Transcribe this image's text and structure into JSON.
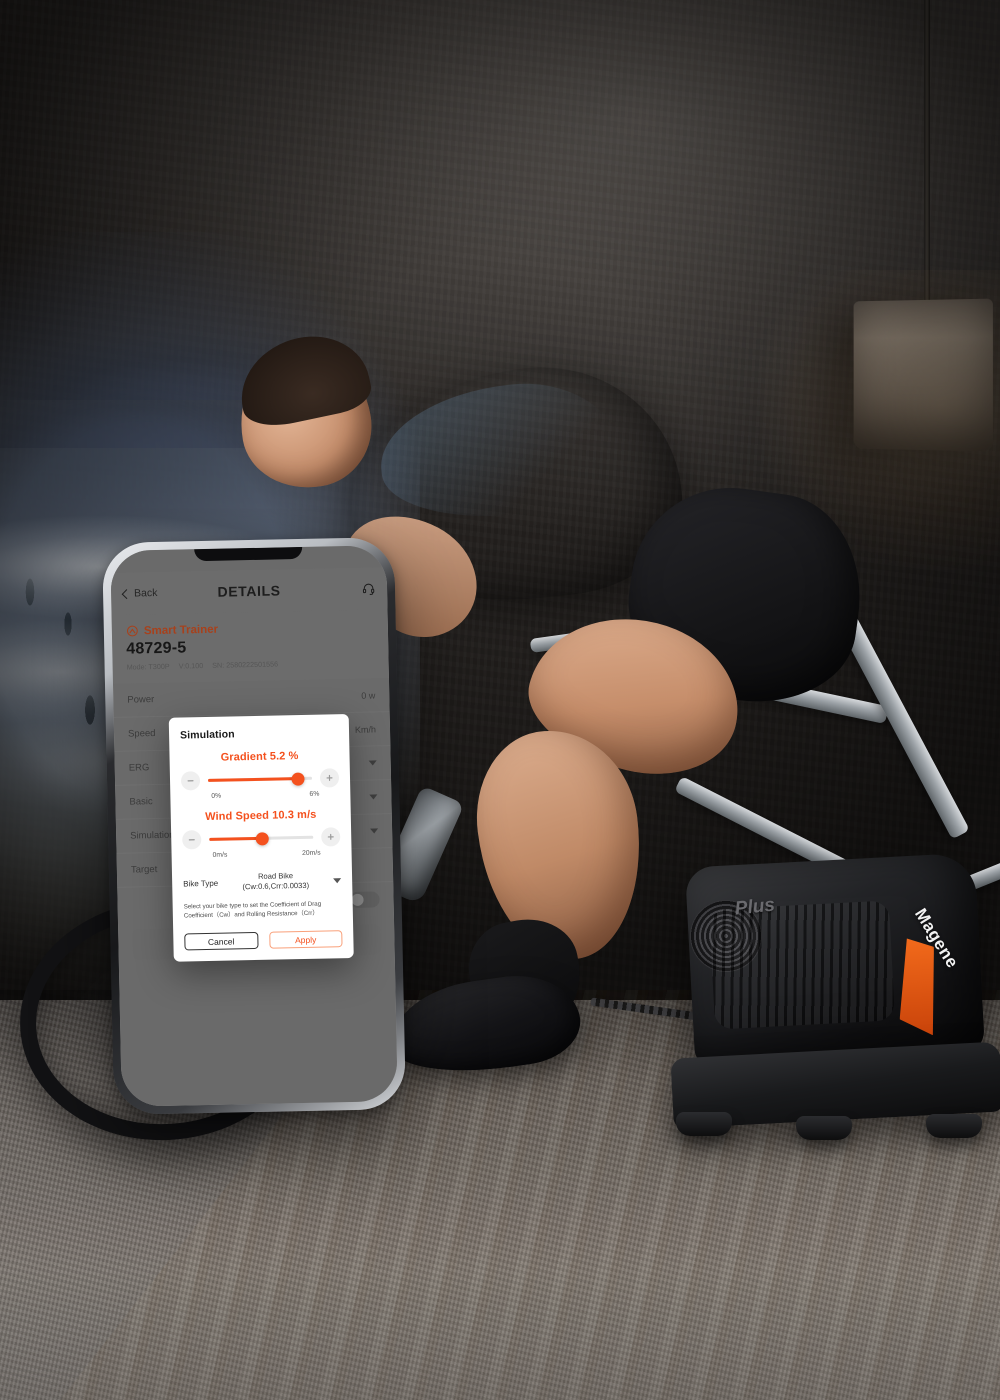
{
  "scene": {
    "description": "Cyclist riding road bike on Magene smart trainer indoors",
    "trainer_brand": "Magene",
    "trainer_model_badge": "Plus",
    "accent_color": "#f4511e",
    "orange_accent": "#f26a1b"
  },
  "phone": {
    "navbar": {
      "back_label": "Back",
      "title": "DETAILS",
      "help_icon": "headset-icon"
    },
    "device": {
      "type_icon": "smart-trainer-icon",
      "type_label": "Smart Trainer",
      "name": "48729-5",
      "mode_label": "Mode: T300P",
      "version_label": "V:0.100",
      "serial_label": "SN: 2580222501556"
    },
    "rows": [
      {
        "label": "Power",
        "value": "0 w",
        "control": "none"
      },
      {
        "label": "Speed",
        "value": "Km/h",
        "control": "none"
      },
      {
        "label": "ERG",
        "value": "",
        "control": "caret"
      },
      {
        "label": "Basic",
        "value": "",
        "control": "caret"
      },
      {
        "label": "Simulation",
        "value": "",
        "control": "caret"
      },
      {
        "label": "Target",
        "value": "",
        "control": "none"
      }
    ]
  },
  "dialog": {
    "title": "Simulation",
    "gradient": {
      "label": "Gradient 5.2 %",
      "min_label": "0%",
      "max_label": "6%",
      "value": 5.2,
      "min": 0,
      "max": 6,
      "percent": 87,
      "minus_icon": "minus-icon",
      "plus_icon": "plus-icon"
    },
    "wind": {
      "label": "Wind Speed 10.3 m/s",
      "min_label": "0m/s",
      "max_label": "20m/s",
      "value": 10.3,
      "min": 0,
      "max": 20,
      "percent": 51,
      "minus_icon": "minus-icon",
      "plus_icon": "plus-icon"
    },
    "bike_type": {
      "label": "Bike Type",
      "value_line1": "Road Bike",
      "value_line2": "(Cw:0.6,Crr:0.0033)",
      "caret_icon": "chevron-down-icon"
    },
    "hint": "Select your bike type to set the Coefficient of Drag Coefficient（Cw）and Rolling Resistance（Crr）",
    "cancel_label": "Cancel",
    "apply_label": "Apply"
  }
}
